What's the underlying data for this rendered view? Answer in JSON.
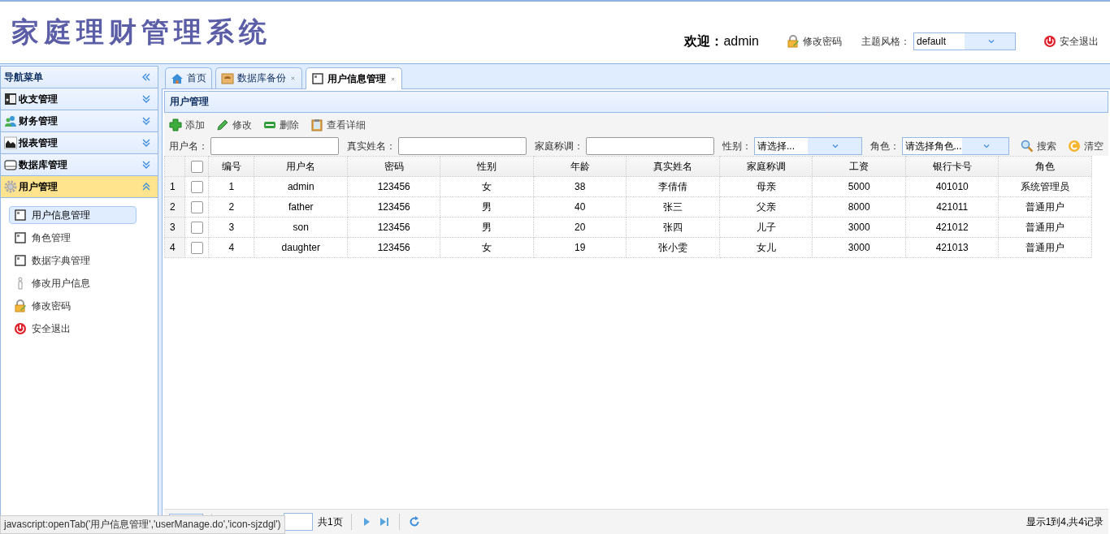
{
  "header": {
    "title": "家庭理财管理系统",
    "welcome_label": "欢迎：",
    "user": "admin",
    "change_password": "修改密码",
    "theme_label": "主题风格：",
    "theme_value": "default",
    "logout": "安全退出"
  },
  "sidebar": {
    "title": "导航菜单",
    "sections": [
      {
        "label": "收支管理",
        "expanded": false
      },
      {
        "label": "财务管理",
        "expanded": false
      },
      {
        "label": "报表管理",
        "expanded": false
      },
      {
        "label": "数据库管理",
        "expanded": false
      },
      {
        "label": "用户管理",
        "expanded": true,
        "children": [
          {
            "label": "用户信息管理",
            "selected": true
          },
          {
            "label": "角色管理",
            "selected": false
          },
          {
            "label": "数据字典管理",
            "selected": false
          },
          {
            "label": "修改用户信息",
            "selected": false
          },
          {
            "label": "修改密码",
            "selected": false
          },
          {
            "label": "安全退出",
            "selected": false
          }
        ]
      }
    ]
  },
  "tabs": [
    {
      "label": "首页",
      "closable": false,
      "selected": false
    },
    {
      "label": "数据库备份",
      "closable": true,
      "selected": false
    },
    {
      "label": "用户信息管理",
      "closable": true,
      "selected": true
    }
  ],
  "panel": {
    "title": "用户管理",
    "toolbar": [
      "添加",
      "修改",
      "删除",
      "查看详细"
    ],
    "filters": [
      {
        "kind": "text",
        "label": "用户名："
      },
      {
        "kind": "text",
        "label": "真实姓名："
      },
      {
        "kind": "text",
        "label": "家庭称调："
      },
      {
        "kind": "select",
        "label": "性别：",
        "value": "请选择..."
      },
      {
        "kind": "select",
        "label": "角色：",
        "value": "请选择角色..."
      }
    ],
    "search_button": "搜索",
    "clear_button": "清空"
  },
  "table": {
    "all_checked": false,
    "columns": [
      "编号",
      "用户名",
      "密码",
      "性别",
      "年龄",
      "真实姓名",
      "家庭称调",
      "工资",
      "银行卡号",
      "角色"
    ],
    "rows": [
      {
        "row_number": "1",
        "checked": false,
        "cells": [
          "1",
          "admin",
          "123456",
          "女",
          "38",
          "李倩倩",
          "母亲",
          "5000",
          "401010",
          "系统管理员"
        ]
      },
      {
        "row_number": "2",
        "checked": false,
        "cells": [
          "2",
          "father",
          "123456",
          "男",
          "40",
          "张三",
          "父亲",
          "8000",
          "421011",
          "普通用户"
        ]
      },
      {
        "row_number": "3",
        "checked": false,
        "cells": [
          "3",
          "son",
          "123456",
          "男",
          "20",
          "张四",
          "儿子",
          "3000",
          "421012",
          "普通用户"
        ]
      },
      {
        "row_number": "4",
        "checked": false,
        "cells": [
          "4",
          "daughter",
          "123456",
          "女",
          "19",
          "张小雯",
          "女儿",
          "3000",
          "421013",
          "普通用户"
        ]
      }
    ]
  },
  "pager": {
    "pages": "共1页",
    "summary": "显示1到4,共4记录"
  },
  "status_tip": "javascript:openTab('用户信息管理','userManage.do','icon-sjzdgl')"
}
